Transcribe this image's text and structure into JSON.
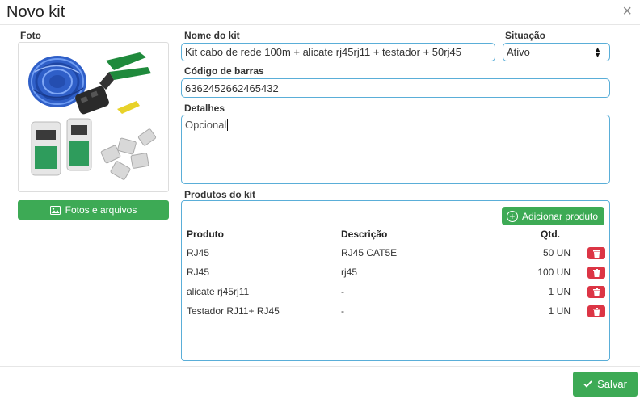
{
  "modal": {
    "title": "Novo kit",
    "close_symbol": "×"
  },
  "photo": {
    "label": "Foto",
    "files_button": "Fotos e arquivos"
  },
  "form": {
    "name_label": "Nome do kit",
    "name_value": "Kit cabo de rede 100m + alicate rj45rj11 + testador + 50rj45",
    "status_label": "Situação",
    "status_value": "Ativo",
    "barcode_label": "Código de barras",
    "barcode_value": "6362452662465432",
    "details_label": "Detalhes",
    "details_placeholder": "Opcional"
  },
  "products": {
    "label": "Produtos do kit",
    "add_button": "Adicionar produto",
    "headers": {
      "product": "Produto",
      "description": "Descrição",
      "qty": "Qtd."
    },
    "rows": [
      {
        "product": "RJ45",
        "description": "RJ45 CAT5E",
        "qty": "50 UN"
      },
      {
        "product": "RJ45",
        "description": "rj45",
        "qty": "100 UN"
      },
      {
        "product": "alicate rj45rj11",
        "description": "-",
        "qty": "1 UN"
      },
      {
        "product": "Testador RJ11+ RJ45",
        "description": "-",
        "qty": "1 UN"
      }
    ]
  },
  "footer": {
    "save_button": "Salvar"
  },
  "colors": {
    "primary_green": "#3daa55",
    "input_border": "#5aaed8",
    "danger": "#dc3545"
  },
  "icons": {
    "close": "close-icon",
    "image": "image-icon",
    "plus": "plus-circle-icon",
    "trash": "trash-icon",
    "check": "check-icon",
    "select": "select-arrows-icon"
  }
}
